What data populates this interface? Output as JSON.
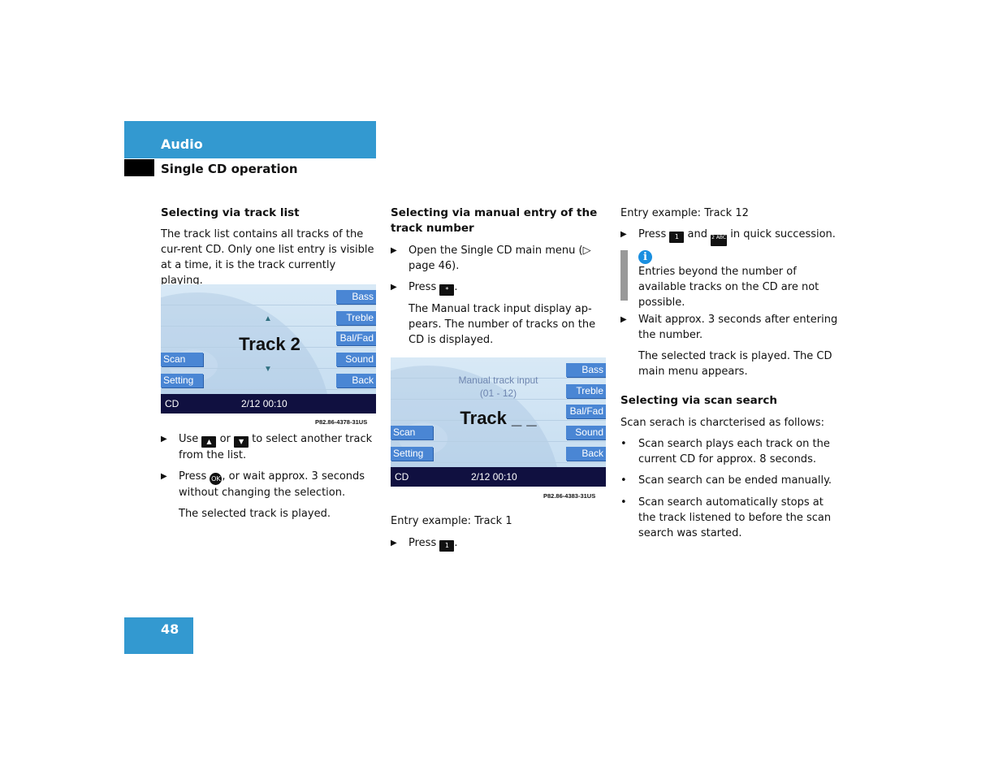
{
  "header": {
    "section": "Audio",
    "subsection": "Single CD operation",
    "accent": "#3399d0"
  },
  "page_number": "48",
  "col1": {
    "heading": "Selecting via track list",
    "intro": "The track list contains all tracks of the cur-rent CD. Only one list entry is visible at a time, it is the track currently playing.",
    "screen": {
      "buttons_right": [
        "Bass",
        "Treble",
        "Bal/Fad",
        "Sound",
        "Back"
      ],
      "buttons_left": [
        "Scan",
        "Setting"
      ],
      "track": "Track 2",
      "up": "▲",
      "down": "▼",
      "bar_source": "CD",
      "bar_status": "2/12  00:10",
      "caption": "P82.86-4378-31US"
    },
    "step1": {
      "a": "Use",
      "up_key": "▲",
      "b": "or",
      "down_key": "▼",
      "c": "to select another track from the list."
    },
    "step2": {
      "a": "Press",
      "ok_key": "OK",
      "b": ", or wait approx. 3 seconds without changing the selection."
    },
    "result": "The selected track is played."
  },
  "col2": {
    "heading": "Selecting via manual entry of the track number",
    "step1": "Open the Single CD main menu (▷ page 46).",
    "step2": {
      "a": "Press",
      "key": "*",
      "b": "."
    },
    "result": "The Manual track input display ap-pears. The number of tracks on the CD is displayed.",
    "screen": {
      "buttons_right": [
        "Bass",
        "Treble",
        "Bal/Fad",
        "Sound",
        "Back"
      ],
      "buttons_left": [
        "Scan",
        "Setting"
      ],
      "title": "Manual track input",
      "range": "(01 - 12)",
      "track": "Track _ _",
      "bar_source": "CD",
      "bar_status": "2/12  00:10",
      "caption": "P82.86-4383-31US"
    },
    "example": "Entry example: Track 1",
    "step3": {
      "a": "Press",
      "key": "1",
      "b": "."
    }
  },
  "col3": {
    "example": "Entry example: Track  12",
    "step1": {
      "a": "Press",
      "key1": "1",
      "b": "and",
      "key2": "2 ABC",
      "c": "in quick succession."
    },
    "info_icon": "info-icon",
    "info": "Entries beyond the number of available tracks on the CD are not possible.",
    "step2": "Wait approx. 3 seconds after entering the number.",
    "result": "The selected track is played. The CD main menu appears.",
    "heading": "Selecting via scan search",
    "intro": "Scan serach is charcterised as follows:",
    "bullets": [
      "Scan search plays each track on the current CD for approx. 8 seconds.",
      "Scan search can be ended manually.",
      "Scan search automatically stops at the track listened to before the scan search was started."
    ]
  }
}
